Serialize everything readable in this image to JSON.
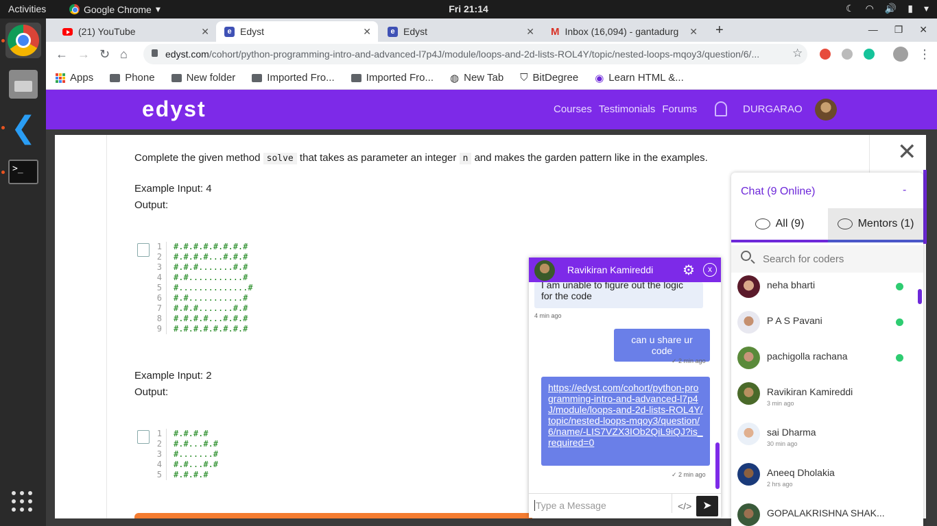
{
  "os": {
    "activities": "Activities",
    "app_menu": "Google Chrome",
    "clock": "Fri 21:14"
  },
  "tabs": [
    {
      "label": "(21) YouTube",
      "favicon": "youtube-icon"
    },
    {
      "label": "Edyst",
      "favicon": "edyst-icon",
      "active": true
    },
    {
      "label": "Edyst",
      "favicon": "edyst-icon"
    },
    {
      "label": "Inbox (16,094) - gantadurg",
      "favicon": "gmail-icon"
    }
  ],
  "address": {
    "host": "edyst.com",
    "path": "/cohort/python-programming-intro-and-advanced-l7p4J/module/loops-and-2d-lists-ROL4Y/topic/nested-loops-mqoy3/question/6/..."
  },
  "bookmarks": [
    "Apps",
    "Phone",
    "New folder",
    "Imported Fro...",
    "Imported Fro...",
    "New Tab",
    "BitDegree",
    "Learn HTML &..."
  ],
  "site": {
    "logo": "edyst",
    "nav": [
      "Courses",
      "Testimonials",
      "Forums"
    ],
    "user": "DURGARAO"
  },
  "problem": {
    "text_before": "Complete the given method ",
    "method": "solve",
    "text_mid": " that takes as parameter an integer ",
    "param": "n",
    "text_after": " and makes the garden pattern like in the examples.",
    "example1_input": "Example Input: 4",
    "example1_output": "Output:",
    "example1_lines": "1\n2\n3\n4\n5\n6\n7\n8\n9",
    "example1_pattern": "#.#.#.#.#.#.#.#\n#.#.#.#...#.#.#\n#.#.#.......#.#\n#.#...........#\n#..............#\n#.#...........#\n#.#.#.......#.#\n#.#.#.#...#.#.#\n#.#.#.#.#.#.#.#",
    "example2_input": "Example Input: 2",
    "example2_output": "Output:",
    "example2_lines": "1\n2\n3\n4\n5",
    "example2_pattern": "#.#.#.#\n#.#...#.#\n#.......#\n#.#...#.#\n#.#.#.#"
  },
  "chat_window": {
    "name": "Ravikiran Kamireddi",
    "msg1": "I am unable to figure out the logic for the code",
    "msg1_time": "4 min ago",
    "msg2": "can u share ur code",
    "msg2_time": "2 min ago",
    "msg3": "https://edyst.com/cohort/python-programming-intro-and-advanced-l7p4J/module/loops-and-2d-lists-ROL4Y/topic/nested-loops-mqoy3/question/6/name/-LIS7VZX3IOb2QiL9iQJ?is_required=0",
    "msg3_time": "2 min ago",
    "input_placeholder": "Type a Message"
  },
  "chat_panel": {
    "title": "Chat (9 Online)",
    "minimize": "-",
    "tab_all": "All (9)",
    "tab_mentors": "Mentors (1)",
    "search_placeholder": "Search for coders",
    "coders": [
      {
        "name": "neha bharti",
        "time": "",
        "online": true
      },
      {
        "name": "P A S Pavani",
        "time": "",
        "online": true
      },
      {
        "name": "pachigolla rachana",
        "time": "",
        "online": true
      },
      {
        "name": "Ravikiran Kamireddi",
        "time": "3 min ago",
        "online": false
      },
      {
        "name": "sai Dharma",
        "time": "30 min ago",
        "online": false
      },
      {
        "name": "Aneeq Dholakia",
        "time": "2 hrs ago",
        "online": false
      },
      {
        "name": "GOPALAKRISHNA SHAK...",
        "time": "",
        "online": false
      }
    ]
  },
  "colors": {
    "brand": "#7d2ae8",
    "online": "#2ecc71",
    "outgoing": "#6a7fe8"
  }
}
